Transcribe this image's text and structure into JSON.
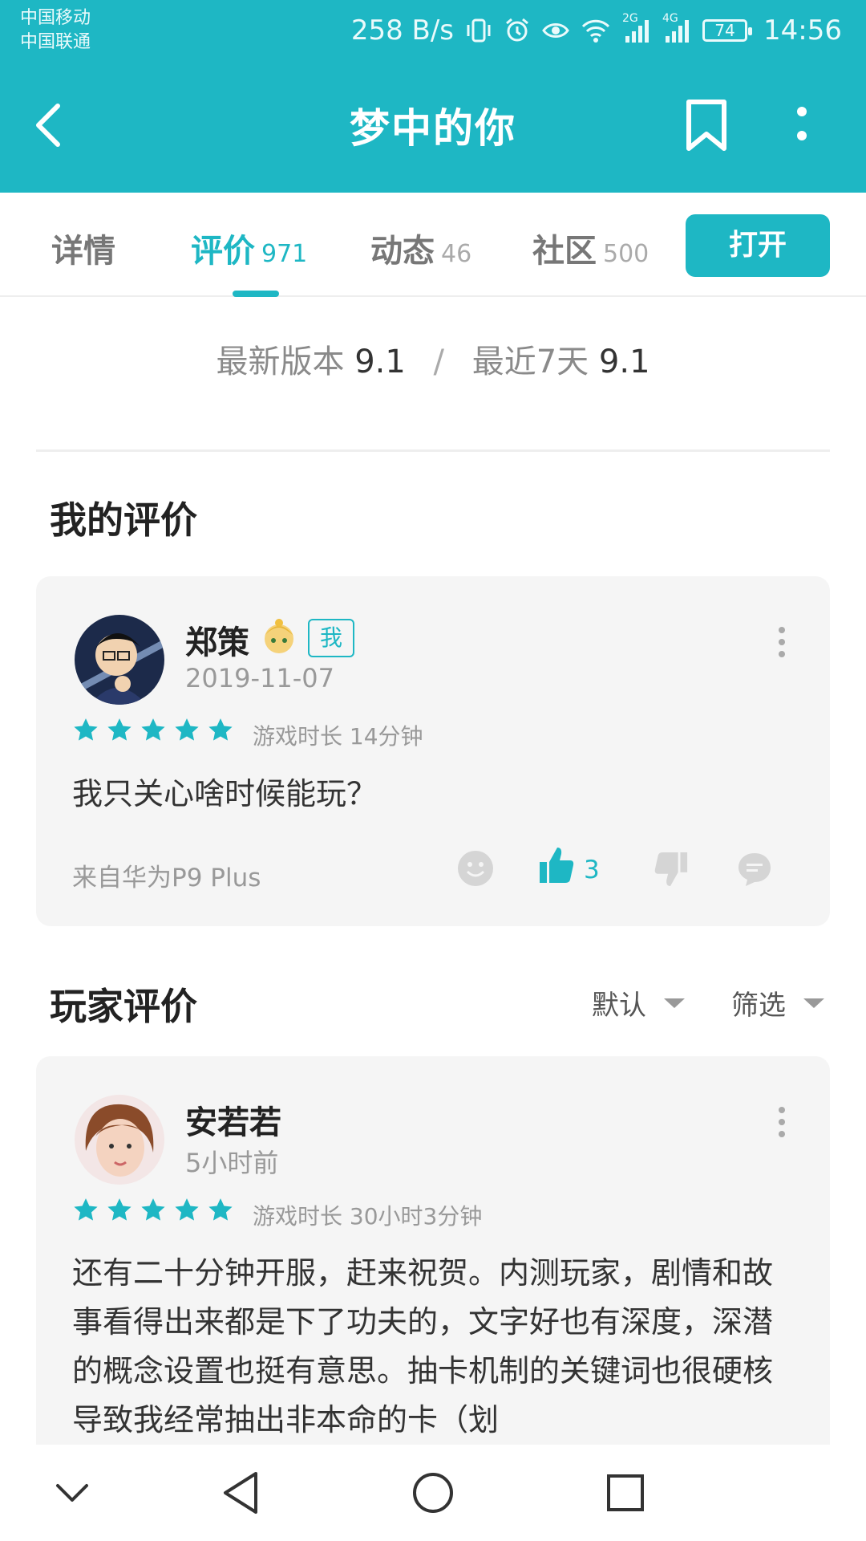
{
  "status_bar": {
    "carrier_1": "中国移动",
    "carrier_2": "中国联通",
    "net_speed": "258 B/s",
    "signal_1_label": "2G",
    "signal_2_label": "4G",
    "battery": "74",
    "time": "14:56"
  },
  "app_bar": {
    "title": "梦中的你"
  },
  "tabs": [
    {
      "label": "详情",
      "count": ""
    },
    {
      "label": "评价",
      "count": "971"
    },
    {
      "label": "动态",
      "count": "46"
    },
    {
      "label": "社区",
      "count": "500"
    }
  ],
  "open_button": "打开",
  "versions": {
    "latest_label": "最新版本",
    "latest_score": "9.1",
    "separator": "/",
    "recent_label": "最近7天",
    "recent_score": "9.1"
  },
  "my_review": {
    "section_title": "我的评价",
    "name": "郑策",
    "me_badge": "我",
    "date": "2019-11-07",
    "rating": 5,
    "playtime": "游戏时长 14分钟",
    "text": "我只关心啥时候能玩？",
    "device": "来自华为P9 Plus",
    "likes": "3"
  },
  "player_reviews": {
    "section_title": "玩家评价",
    "sort_label": "默认",
    "filter_label": "筛选",
    "first": {
      "name": "安若若",
      "time": "5小时前",
      "rating": 5,
      "playtime": "游戏时长 30小时3分钟",
      "text": "还有二十分钟开服，赶来祝贺。内测玩家，剧情和故事看得出来都是下了功夫的，文字好也有深度，深潜的概念设置也挺有意思。抽卡机制的关键词也很硬核导致我经常抽出非本命的卡（划"
    }
  },
  "colors": {
    "accent": "#1eb7c4",
    "card_bg": "#f5f5f5"
  }
}
